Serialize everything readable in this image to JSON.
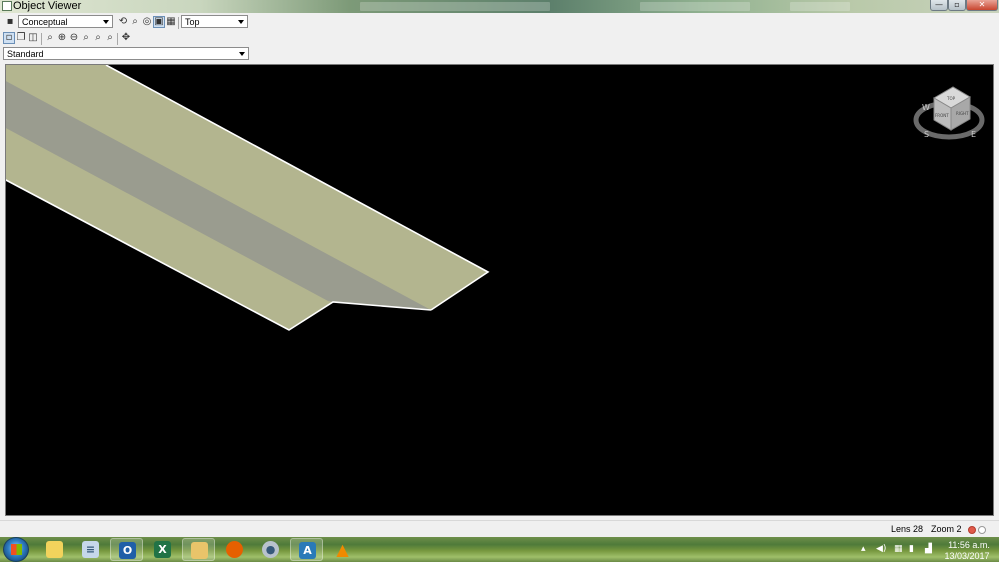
{
  "window": {
    "title": "Object Viewer",
    "controls": {
      "minimize": "—",
      "maximize": "▫",
      "close": "✕"
    }
  },
  "toolbar": {
    "visual_style": "Conceptual",
    "view": "Top",
    "ucs": "Standard",
    "icons_row1": [
      "save-icon",
      "orbit-icon",
      "zoom-icon",
      "fit-icon",
      "preview-icon",
      "gallery-icon"
    ],
    "icons_row2": [
      "view-cube-icon",
      "view-copy-icon",
      "camera-icon",
      "zoom-realtime-icon",
      "zoom-in-icon",
      "zoom-out-icon",
      "zoom-window-icon",
      "zoom-extents-icon",
      "zoom-previous-icon",
      "pan-icon"
    ]
  },
  "viewcube": {
    "compass": [
      "N",
      "E",
      "S",
      "W"
    ],
    "faces": [
      "TOP",
      "FRONT",
      "RIGHT"
    ]
  },
  "status": {
    "lens": "Lens 28",
    "zoom": "Zoom 2"
  },
  "taskbar": {
    "apps": [
      "explorer",
      "notepad",
      "outlook",
      "excel",
      "file-manager",
      "firefox",
      "chat",
      "autocad",
      "vlc"
    ],
    "clock_time": "11:56 a.m.",
    "clock_date": "13/03/2017"
  },
  "colors": {
    "viewport_bg": "#000000",
    "road_surface": "#b3b58f",
    "road_center": "#9a9c8f",
    "edge_line": "#ffffff"
  }
}
